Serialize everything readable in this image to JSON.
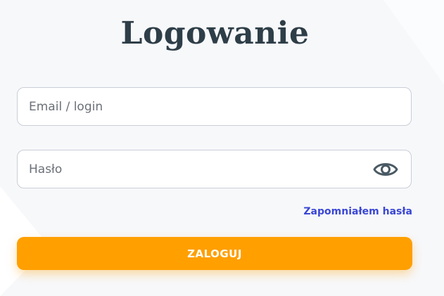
{
  "login": {
    "title": "Logowanie",
    "email_placeholder": "Email / login",
    "email_value": "",
    "password_placeholder": "Hasło",
    "password_value": "",
    "password_toggle_icon": "eye-icon",
    "forgot_password_label": "Zapomniałem hasła",
    "submit_label": "ZALOGUJ"
  },
  "colors": {
    "background": "#f7f8fa",
    "title": "#2e3e48",
    "accent_button": "#ff9f00",
    "link": "#3a47d5",
    "field_border": "#c9ced6",
    "icon": "#4a5a64"
  }
}
